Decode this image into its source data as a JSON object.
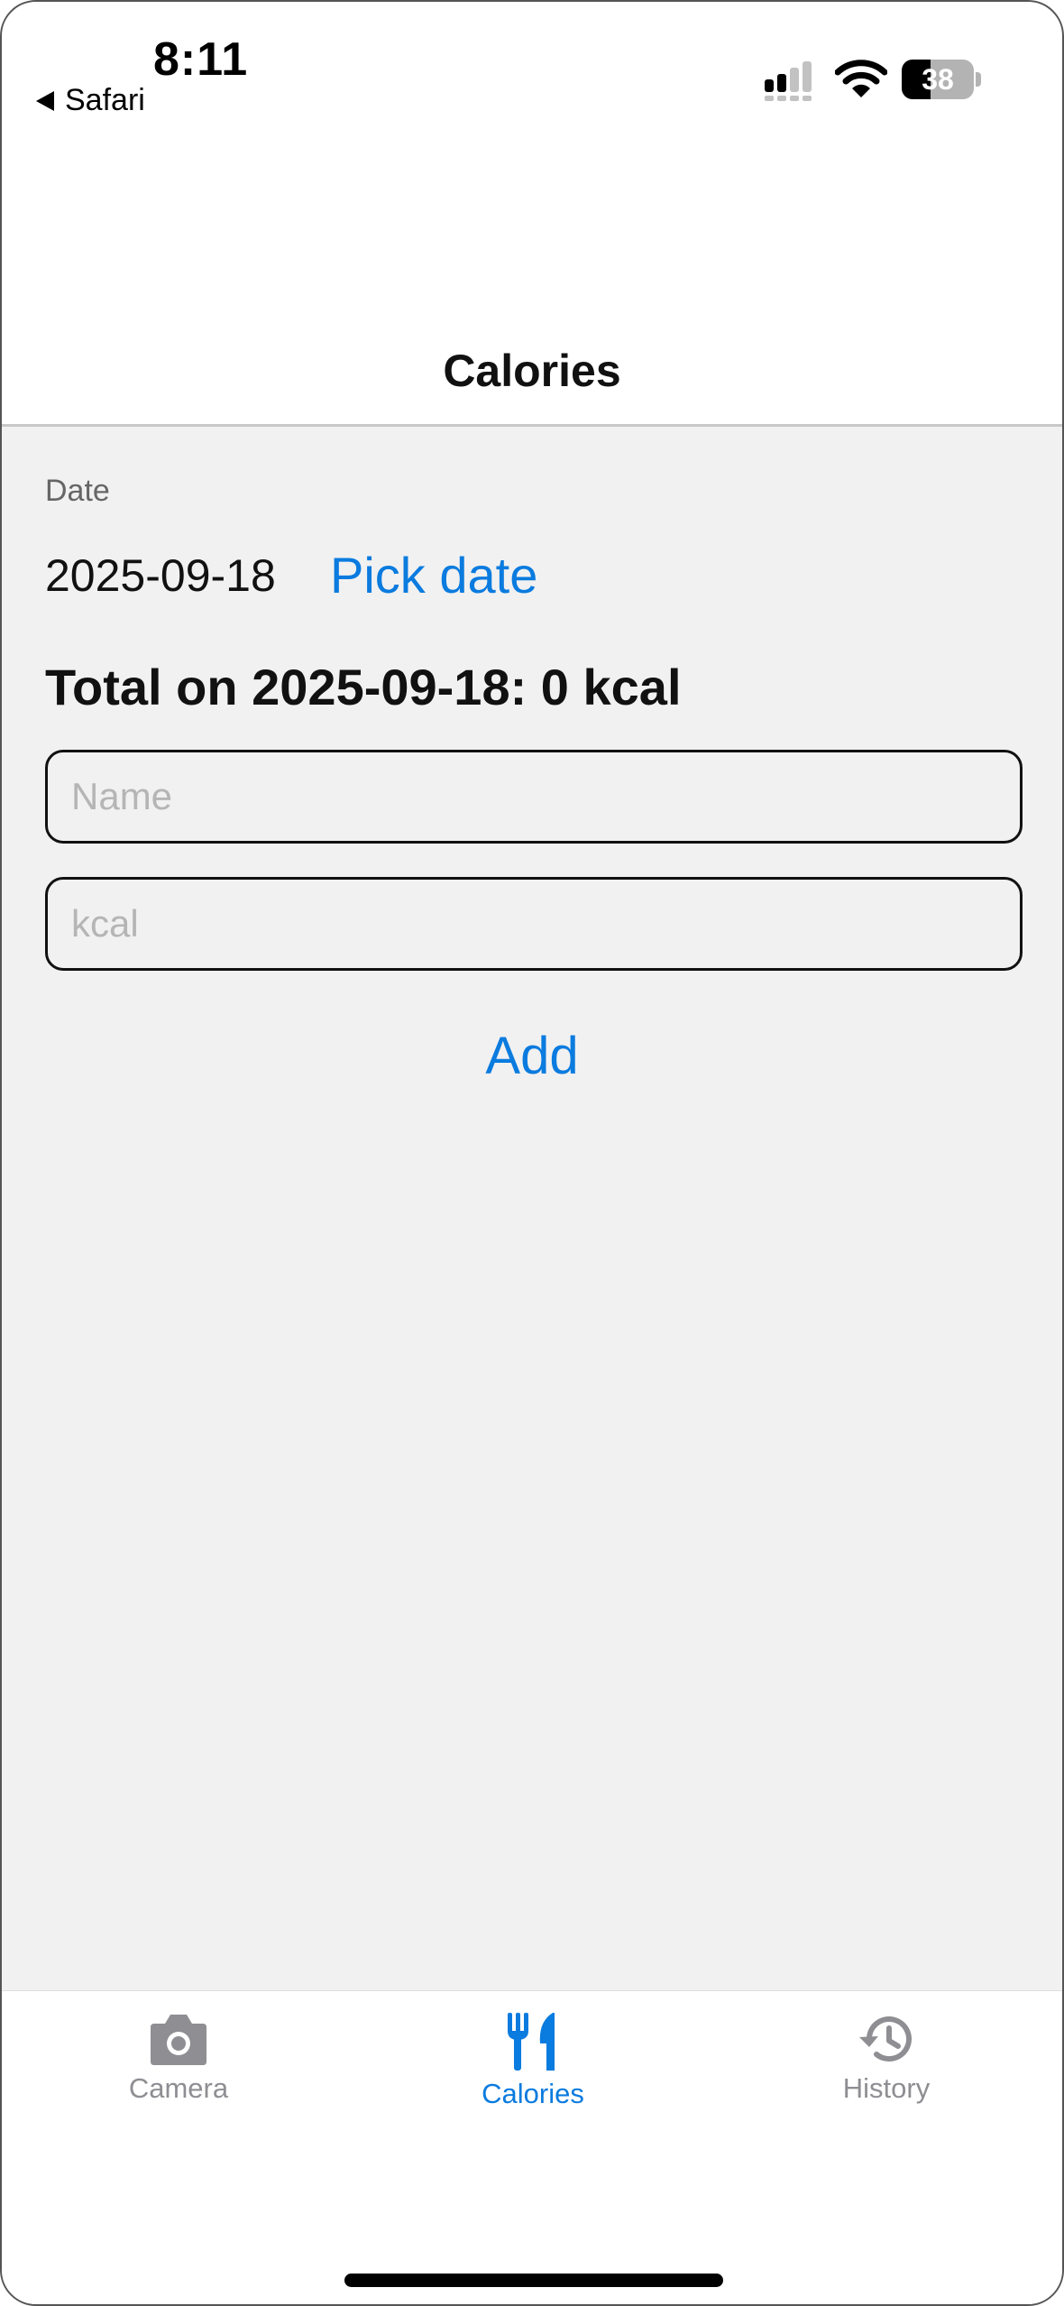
{
  "status_bar": {
    "time": "8:11",
    "back_app": "Safari",
    "battery_level": "38",
    "icons": [
      "signal-icon",
      "wifi-icon",
      "battery-icon"
    ]
  },
  "nav": {
    "title": "Calories"
  },
  "form": {
    "date_label": "Date",
    "date_value": "2025-09-18",
    "pick_date_label": "Pick date",
    "total_text": "Total on 2025-09-18: 0 kcal",
    "name_placeholder": "Name",
    "kcal_placeholder": "kcal",
    "add_label": "Add"
  },
  "tabbar": {
    "active_tab": "Calories",
    "tabs": [
      {
        "label": "Camera",
        "icon": "camera-icon"
      },
      {
        "label": "Calories",
        "icon": "fork-knife-icon"
      },
      {
        "label": "History",
        "icon": "history-clock-icon"
      }
    ]
  },
  "colors": {
    "accent": "#0a7bdf",
    "inactive": "#8e8e93",
    "content_background": "#f1f1f1"
  }
}
